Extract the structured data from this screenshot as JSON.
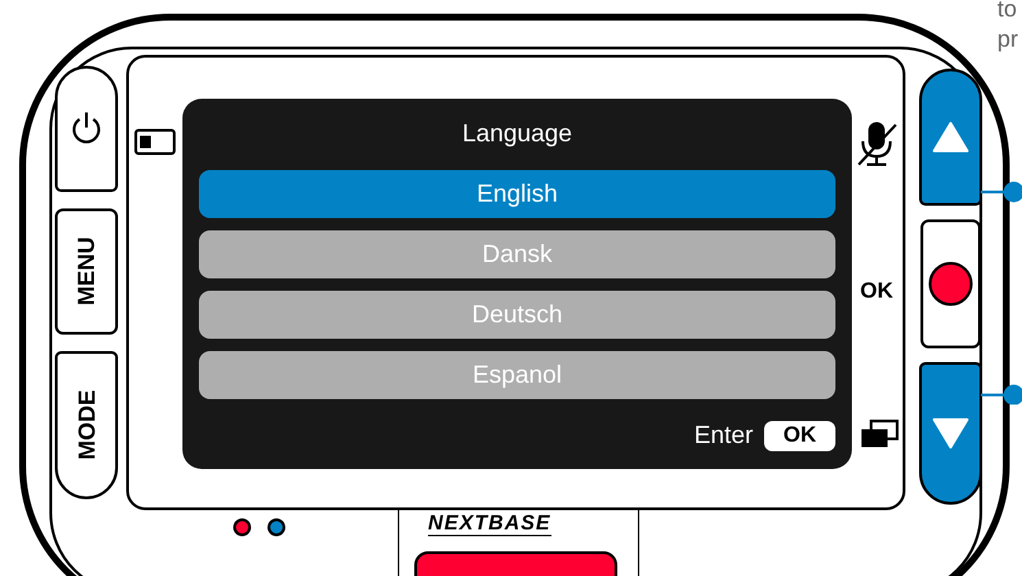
{
  "caption_fragments": [
    "to",
    "pr"
  ],
  "left_buttons": [
    {
      "kind": "power"
    },
    {
      "kind": "text",
      "label": "MENU"
    },
    {
      "kind": "text",
      "label": "MODE"
    }
  ],
  "screen": {
    "title": "Language",
    "options": [
      {
        "label": "English",
        "selected": true
      },
      {
        "label": "Dansk",
        "selected": false
      },
      {
        "label": "Deutsch",
        "selected": false
      },
      {
        "label": "Espanol",
        "selected": false
      }
    ],
    "footer": {
      "label": "Enter",
      "key": "OK"
    }
  },
  "ok_label": "OK",
  "brand": "NEXTBASE"
}
